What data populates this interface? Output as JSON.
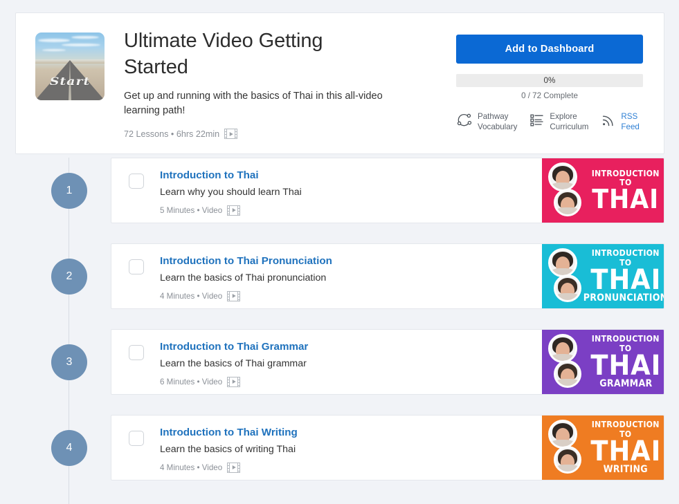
{
  "header": {
    "thumbnail_alt": "start-road-photo",
    "thumbnail_word": "Start",
    "title": "Ultimate Video Getting Started",
    "description": "Get up and running with the basics of Thai in this all-video learning path!",
    "meta": "72 Lessons • 6hrs 22min",
    "meta_icon": "video-film-icon",
    "add_button": "Add to Dashboard",
    "progress_percent": "0%",
    "progress_value": 0,
    "progress_complete": "0 / 72 Complete",
    "links": [
      {
        "icon": "pathway-vocabulary-icon",
        "line1": "Pathway",
        "line2": "Vocabulary",
        "blue": false
      },
      {
        "icon": "explore-curriculum-icon",
        "line1": "Explore",
        "line2": "Curriculum",
        "blue": false
      },
      {
        "icon": "rss-feed-icon",
        "line1": "RSS",
        "line2": "Feed",
        "blue": true
      }
    ]
  },
  "colors": {
    "page_bg": "#f1f3f7",
    "card_bg": "#ffffff",
    "accent_blue": "#0b69d4",
    "link_blue": "#1f72bd",
    "step_circle": "#6e91b5",
    "timeline_line": "#d7dce3",
    "progress_track": "#ececec"
  },
  "lessons": [
    {
      "step": "1",
      "checked": false,
      "title": "Introduction to Thai",
      "description": "Learn why you should learn Thai",
      "meta": "5 Minutes • Video",
      "meta_icon": "video-film-icon",
      "thumb": {
        "bg": "#e8205e",
        "line1": "INTRODUCTION",
        "line2": "TO",
        "line3": "THAI",
        "style": "three-line"
      }
    },
    {
      "step": "2",
      "checked": false,
      "title": "Introduction to Thai Pronunciation",
      "description": "Learn the basics of Thai pronunciation",
      "meta": "4 Minutes • Video",
      "meta_icon": "video-film-icon",
      "thumb": {
        "bg": "#19bdd6",
        "line1": "INTRODUCTION TO",
        "line2": "THAI",
        "line3": "PRONUNCIATION",
        "style": "stacked"
      }
    },
    {
      "step": "3",
      "checked": false,
      "title": "Introduction to Thai Grammar",
      "description": "Learn the basics of Thai grammar",
      "meta": "6 Minutes • Video",
      "meta_icon": "video-film-icon",
      "thumb": {
        "bg": "#7b3fc4",
        "line1": "INTRODUCTION TO",
        "line2": "THAI",
        "line3": "GRAMMAR",
        "style": "stacked"
      }
    },
    {
      "step": "4",
      "checked": false,
      "title": "Introduction to Thai Writing",
      "description": "Learn the basics of writing Thai",
      "meta": "4 Minutes • Video",
      "meta_icon": "video-film-icon",
      "thumb": {
        "bg": "#ef7c22",
        "line1": "INTRODUCTION TO",
        "line2": "THAI",
        "line3": "WRITING",
        "style": "stacked"
      }
    }
  ]
}
